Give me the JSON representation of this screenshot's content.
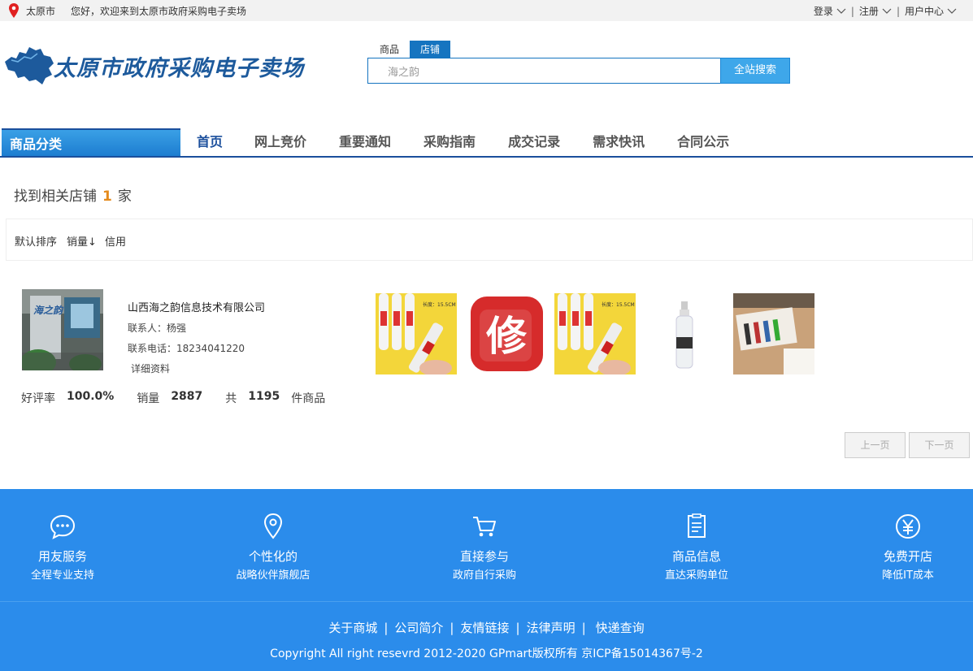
{
  "topbar": {
    "city": "太原市",
    "welcome": "您好，欢迎来到太原市政府采购电子卖场",
    "login": "登录",
    "register": "注册",
    "user_center": "用户中心",
    "separator": "|"
  },
  "header": {
    "logo_text": "太原市政府采购电子卖场",
    "search_tabs": [
      "商品",
      "店铺"
    ],
    "active_tab": "店铺",
    "search_value": "海之韵",
    "search_button": "全站搜索"
  },
  "nav": {
    "category": "商品分类",
    "items": [
      "首页",
      "网上竞价",
      "重要通知",
      "采购指南",
      "成交记录",
      "需求快讯",
      "合同公示"
    ],
    "active": "首页"
  },
  "results": {
    "prefix": "找到相关店铺",
    "count": "1",
    "suffix": "家"
  },
  "sort": {
    "default": "默认排序",
    "sales": "销量↓",
    "credit": "信用"
  },
  "store": {
    "name": "山西海之韵信息技术有限公司",
    "contact_label": "联系人：",
    "contact": "杨强",
    "phone_label": "联系电话：",
    "phone": "18234041220",
    "detail": "详细资料",
    "rating_label": "好评率",
    "rating": "100.0%",
    "sales_label": "销量",
    "sales": "2887",
    "total_label": "共",
    "total": "1195",
    "total_unit": "件商品",
    "product_badge_text": "修",
    "product_label_text": "长度：15.5CM"
  },
  "pager": {
    "prev": "上一页",
    "next": "下一页"
  },
  "footer": {
    "features": [
      {
        "icon": "chat-icon",
        "title": "用友服务",
        "sub": "全程专业支持"
      },
      {
        "icon": "location-icon",
        "title": "个性化的",
        "sub": "战略伙伴旗舰店"
      },
      {
        "icon": "cart-icon",
        "title": "直接参与",
        "sub": "政府自行采购"
      },
      {
        "icon": "document-icon",
        "title": "商品信息",
        "sub": "直达采购单位"
      },
      {
        "icon": "yen-icon",
        "title": "免费开店",
        "sub": "降低IT成本"
      }
    ],
    "links": [
      "关于商城",
      "公司简介",
      "友情链接",
      "法律声明",
      "快递查询"
    ],
    "separator": "|",
    "copyright": "Copyright All right resevrd 2012-2020  GPmart版权所有 京ICP备15014367号-2"
  },
  "colors": {
    "brand_blue": "#1b4f9c",
    "footer_blue": "#2b8ceb",
    "accent_orange": "#e48a1c",
    "search_button": "#3ea7ea"
  }
}
